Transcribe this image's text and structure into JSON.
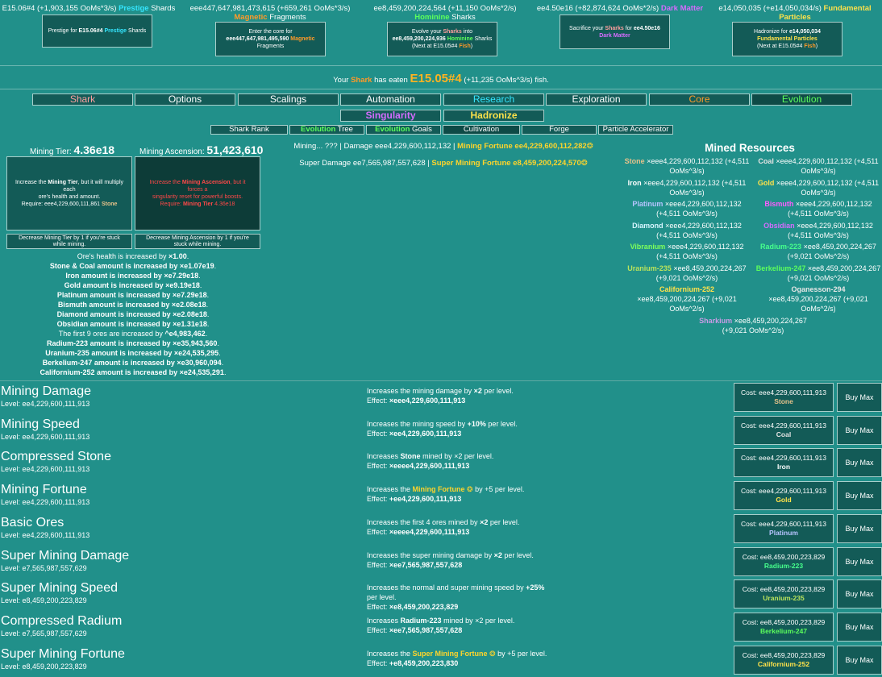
{
  "currencies": [
    {
      "text_value": "E15.06#4 (+1,903,155 OoMs*3/s)",
      "text_name": "Prestige",
      "text_suffix": "Shards",
      "btn_line1_pre": "Prestige for",
      "btn_line1_val": "E15.06#4",
      "btn_line1_name": "Prestige",
      "btn_line1_post": "Shards",
      "btn_line2": ""
    },
    {
      "text_value": "eee447,647,981,473,615 (+659,261 OoMs*3/s)",
      "text_name": "Magnetic",
      "text_suffix": "Fragments",
      "btn_line1_pre": "Enter the core for",
      "btn_line1_val": "eee447,647,981,495,590",
      "btn_line1_name": "Magnetic",
      "btn_line1_post": "Fragments",
      "btn_line2": ""
    },
    {
      "text_value": "ee8,459,200,224,564 (+11,150 OoMs*2/s)",
      "text_name": "Hominine",
      "text_suffix": "Sharks",
      "btn_line1_pre": "Evolve your",
      "btn_line1_name_shark": "Sharks",
      "btn_line1_mid": "into",
      "btn_line1_val": "ee8,459,200,224,936",
      "btn_line1_name": "Hominine",
      "btn_line1_post": "Sharks",
      "btn_line2": "(Next at E15.05#4",
      "btn_line2_fish": "Fish",
      "btn_line2_close": ")"
    },
    {
      "text_value": "ee4.50e16 (+82,874,624 OoMs*2/s)",
      "text_name": "Dark Matter",
      "text_suffix": "",
      "btn_line1_pre": "Sacrifice your",
      "btn_line1_name_shark": "Sharks",
      "btn_line1_mid": "for",
      "btn_line1_val": "ee4.50e16",
      "btn_line1_name": "Dark Matter",
      "btn_line1_post": ""
    },
    {
      "text_value": "e14,050,035 (+e14,050,034/s)",
      "text_name": "Fundamental Particles",
      "text_suffix": "",
      "btn_line1_pre": "Hadronize for",
      "btn_line1_val": "e14,050,034",
      "btn_line1_name": "Fundamental Particles",
      "btn_line2": "(Next at E15.05#4",
      "btn_line2_fish": "Fish",
      "btn_line2_close": ")"
    }
  ],
  "eaten": {
    "pre": "Your",
    "shark": "Shark",
    "mid": "has eaten",
    "value": "E15.05#4",
    "post": "(+11,235 OoMs^3/s) fish."
  },
  "tabs": [
    "Shark",
    "Options",
    "Scalings",
    "Automation",
    "Research",
    "Exploration",
    "Core",
    "Evolution"
  ],
  "tabs2": [
    "Singularity",
    "Hadronize"
  ],
  "subtabs": {
    "shark_rank": "Shark Rank",
    "evolution_word": "Evolution",
    "tree": "Tree",
    "goals": "Goals",
    "cultivation": "Cultivation",
    "forge": "Forge",
    "particle_accelerator": "Particle Accelerator"
  },
  "mining": {
    "tier_label": "Mining Tier:",
    "tier_value": "4.36e18",
    "asc_label": "Mining Ascension:",
    "asc_value": "51,423,610",
    "tier_box_line1_pre": "Increase the",
    "tier_box_line1_bold": "Mining Tier",
    "tier_box_line1_post": ", but it will multiply each",
    "tier_box_line2": "ore's health and amount.",
    "tier_box_line3_pre": "Require: eee4,229,600,111,861",
    "tier_box_line3_res": "Stone",
    "asc_box_line1_pre": "Increase the",
    "asc_box_line1_bold": "Mining Ascension",
    "asc_box_line1_post": ", but it forces a",
    "asc_box_line2": "singularity reset for powerful boosts.",
    "asc_box_line3_pre": "Require:",
    "asc_box_line3_bold": "Mining Tier",
    "asc_box_line3_val": "4.36e18",
    "dec_tier": "Decrease Mining Tier by 1 if you're stuck while mining.",
    "dec_asc": "Decrease Mining Ascension by 1 if you're stuck while mining.",
    "mining_status": "Mining... ???",
    "damage": "| Damage eee4,229,600,112,132 |",
    "fortune_label": "Mining Fortune",
    "fortune_value": "ee4,229,600,112,282",
    "super_damage": "Super Damage ee7,565,987,557,628 |",
    "super_fortune_label": "Super Mining Fortune",
    "super_fortune_value": "e8,459,200,224,570"
  },
  "effects": [
    {
      "pre": "Ore's health is increased by",
      "val": "×1.00",
      "post": "."
    },
    {
      "pre": "Stone & Coal amount is increased by",
      "val": "×e1.07e19",
      "post": "."
    },
    {
      "pre": "Iron amount is increased by",
      "val": "×e7.29e18",
      "post": "."
    },
    {
      "pre": "Gold amount is increased by",
      "val": "×e9.19e18",
      "post": "."
    },
    {
      "pre": "Platinum amount is increased by",
      "val": "×e7.29e18",
      "post": "."
    },
    {
      "pre": "Bismuth amount is increased by",
      "val": "×e2.08e18",
      "post": "."
    },
    {
      "pre": "Diamond amount is increased by",
      "val": "×e2.08e18",
      "post": "."
    },
    {
      "pre": "Obsidian amount is increased by",
      "val": "×e1.31e18",
      "post": "."
    },
    {
      "pre": "The first 9 ores are increased by",
      "val": "^e4,983,462",
      "post": "."
    },
    {
      "pre": "Radium-223 amount is increased by",
      "val": "×e35,943,560",
      "post": "."
    },
    {
      "pre": "Uranium-235 amount is increased by",
      "val": "×e24,535,295",
      "post": "."
    },
    {
      "pre": "Berkelium-247 amount is increased by",
      "val": "×e30,960,094",
      "post": "."
    },
    {
      "pre": "Californium-252 amount is increased by",
      "val": "×e24,535,291",
      "post": "."
    }
  ],
  "resources": {
    "title": "Mined Resources",
    "items": [
      {
        "name": "Stone",
        "value": "×eee4,229,600,112,132 (+4,511",
        "rate": "OoMs^3/s)",
        "color": "#e6c28a"
      },
      {
        "name": "Coal",
        "value": "×eee4,229,600,112,132 (+4,511",
        "rate": "OoMs^3/s)",
        "color": "#e3e3e3"
      },
      {
        "name": "Iron",
        "value": "×eee4,229,600,112,132 (+4,511",
        "rate": "OoMs^3/s)",
        "color": "#ffffff"
      },
      {
        "name": "Gold",
        "value": "×eee4,229,600,112,132 (+4,511",
        "rate": "OoMs^3/s)",
        "color": "#ffe24a"
      },
      {
        "name": "Platinum",
        "value": "×eee4,229,600,112,132",
        "rate": "(+4,511 OoMs^3/s)",
        "color": "#b7c4ff"
      },
      {
        "name": "Bismuth",
        "value": "×eee4,229,600,112,132",
        "rate": "(+4,511 OoMs^3/s)",
        "color": "#ff5cff"
      },
      {
        "name": "Diamond",
        "value": "×eee4,229,600,112,132",
        "rate": "(+4,511 OoMs^3/s)",
        "color": "#d6f5ff"
      },
      {
        "name": "Obsidian",
        "value": "×eee4,229,600,112,132",
        "rate": "(+4,511 OoMs^3/s)",
        "color": "#d56cff"
      },
      {
        "name": "Vibranium",
        "value": "×eee4,229,600,112,132",
        "rate": "(+4,511 OoMs^3/s)",
        "color": "#7dff5c"
      },
      {
        "name": "Radium-223",
        "value": "×ee8,459,200,224,267",
        "rate": "(+9,021 OoMs^2/s)",
        "color": "#46ff8c"
      },
      {
        "name": "Uranium-235",
        "value": "×ee8,459,200,224,267",
        "rate": "(+9,021 OoMs^2/s)",
        "color": "#b9e35c"
      },
      {
        "name": "Berkelium-247",
        "value": "×ee8,459,200,224,267",
        "rate": "(+9,021 OoMs^2/s)",
        "color": "#5cff5c"
      },
      {
        "name": "Californium-252",
        "value": "×ee8,459,200,224,267 (+9,021",
        "rate": "OoMs^2/s)",
        "color": "#ffe24a"
      },
      {
        "name": "Oganesson-294",
        "value": "×ee8,459,200,224,267 (+9,021",
        "rate": "OoMs^2/s)",
        "color": "#e6e6e6"
      },
      {
        "name": "Sharkium",
        "value": "×ee8,459,200,224,267",
        "rate": "(+9,021 OoMs^2/s)",
        "color": "#c99ce6"
      }
    ]
  },
  "upgrades": [
    {
      "name": "Mining Damage",
      "level": "Level: ee4,229,600,111,913",
      "desc_pre": "Increases the mining damage by",
      "desc_bold": "×2",
      "desc_post": "per level.",
      "desc_extra": "",
      "effect_label": "Effect:",
      "effect": "×eee4,229,600,111,913",
      "cost": "Cost: eee4,229,600,111,913",
      "cost_res": "Stone",
      "cost_color": "#e6c28a",
      "buy": "Buy Max"
    },
    {
      "name": "Mining Speed",
      "level": "Level: ee4,229,600,111,913",
      "desc_pre": "Increases the mining speed by",
      "desc_bold": "+10%",
      "desc_post": "per level.",
      "desc_extra": "",
      "effect_label": "Effect:",
      "effect": "×ee4,229,600,111,913",
      "cost": "Cost: eee4,229,600,111,913",
      "cost_res": "Coal",
      "cost_color": "#e3e3e3",
      "buy": "Buy Max"
    },
    {
      "name": "Compressed Stone",
      "level": "Level: ee4,229,600,111,913",
      "desc_pre": "Increases",
      "desc_bold": "Stone",
      "desc_post": "mined by ×2 per level.",
      "desc_extra": "",
      "effect_label": "Effect:",
      "effect": "×eeee4,229,600,111,913",
      "cost": "Cost: eee4,229,600,111,913",
      "cost_res": "Iron",
      "cost_color": "#ffffff",
      "buy": "Buy Max"
    },
    {
      "name": "Mining Fortune",
      "level": "Level: ee4,229,600,111,913",
      "desc_pre": "Increases the",
      "desc_bold": "Mining Fortune",
      "desc_post": "by +5 per level.",
      "desc_extra": "",
      "effect_label": "Effect:",
      "effect": "+ee4,229,600,111,913",
      "cost": "Cost: eee4,229,600,111,913",
      "cost_res": "Gold",
      "cost_color": "#ffe24a",
      "buy": "Buy Max"
    },
    {
      "name": "Basic Ores",
      "level": "Level: ee4,229,600,111,913",
      "desc_pre": "Increases the first 4 ores mined by",
      "desc_bold": "×2",
      "desc_post": "per level.",
      "desc_extra": "",
      "effect_label": "Effect:",
      "effect": "×eeee4,229,600,111,913",
      "cost": "Cost: eee4,229,600,111,913",
      "cost_res": "Platinum",
      "cost_color": "#b7c4ff",
      "buy": "Buy Max"
    },
    {
      "name": "Super Mining Damage",
      "level": "Level: e7,565,987,557,629",
      "desc_pre": "Increases the super mining damage by",
      "desc_bold": "×2",
      "desc_post": "per level.",
      "desc_extra": "",
      "effect_label": "Effect:",
      "effect": "×ee7,565,987,557,628",
      "cost": "Cost: ee8,459,200,223,829",
      "cost_res": "Radium-223",
      "cost_color": "#46ff8c",
      "buy": "Buy Max"
    },
    {
      "name": "Super Mining Speed",
      "level": "Level: e8,459,200,223,829",
      "desc_pre": "Increases the normal and super mining speed by",
      "desc_bold": "+25%",
      "desc_post": "",
      "desc_extra": "per level.",
      "effect_label": "Effect:",
      "effect": "×e8,459,200,223,829",
      "cost": "Cost: ee8,459,200,223,829",
      "cost_res": "Uranium-235",
      "cost_color": "#b9e35c",
      "buy": "Buy Max"
    },
    {
      "name": "Compressed Radium",
      "level": "Level: e7,565,987,557,629",
      "desc_pre": "Increases",
      "desc_bold": "Radium-223",
      "desc_post": "mined by ×2 per level.",
      "desc_extra": "",
      "effect_label": "Effect:",
      "effect": "×ee7,565,987,557,628",
      "cost": "Cost: ee8,459,200,223,829",
      "cost_res": "Berkelium-247",
      "cost_color": "#5cff5c",
      "buy": "Buy Max"
    },
    {
      "name": "Super Mining Fortune",
      "level": "Level: e8,459,200,223,829",
      "desc_pre": "Increases the",
      "desc_bold": "Super Mining Fortune",
      "desc_post": "by +5 per level.",
      "desc_extra": "",
      "effect_label": "Effect:",
      "effect": "+e8,459,200,223,830",
      "cost": "Cost: ee8,459,200,223,829",
      "cost_res": "Californium-252",
      "cost_color": "#ffe24a",
      "buy": "Buy Max"
    }
  ]
}
